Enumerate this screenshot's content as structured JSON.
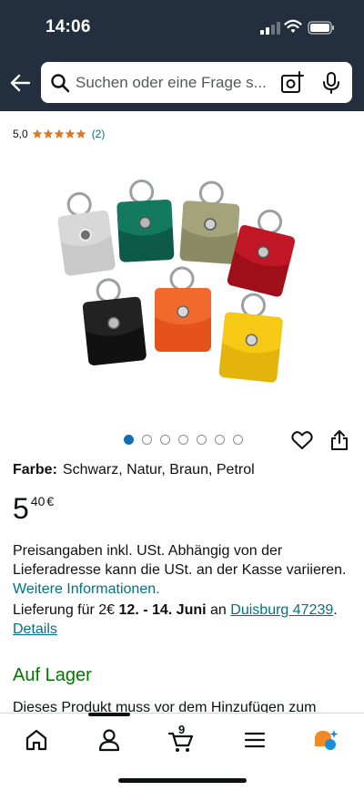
{
  "status": {
    "time": "14:06"
  },
  "search": {
    "placeholder": "Suchen oder eine Frage s..."
  },
  "rating": {
    "value": "5,0",
    "stars": 5,
    "count": "(2)"
  },
  "gallery": {
    "image_count": 7,
    "active_index": 0,
    "image_icon": "product-photo"
  },
  "product": {
    "color_label": "Farbe:",
    "color_value": "Schwarz, Natur, Braun, Petrol",
    "price_whole": "5",
    "price_fraction": "40",
    "price_currency": "€"
  },
  "info": {
    "vat_text": "Preisangaben inkl. USt. Abhängig von der Lieferadresse kann die USt. an der Kasse variieren.",
    "more_info": "Weitere Informationen.",
    "delivery_prefix": "Lieferung für 2€",
    "delivery_dates": "12. - 14. Juni",
    "delivery_to": "an",
    "delivery_location": "Duisburg 47239",
    "delivery_suffix": ".",
    "details": "Details"
  },
  "stock": {
    "status": "Auf Lager"
  },
  "notice": {
    "text": "Dieses Produkt muss vor dem Hinzufügen zum"
  },
  "nav": {
    "cart_count": "9"
  },
  "colors": {
    "header": "#232f3e",
    "link": "#007185",
    "in_stock": "#007600",
    "star": "#de7921",
    "active_dot": "#146eb4"
  }
}
